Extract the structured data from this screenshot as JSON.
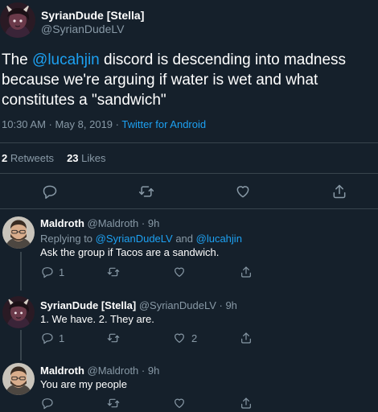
{
  "main_tweet": {
    "author_name": "SyrianDude [Stella]",
    "author_handle": "@SyrianDudeLV",
    "text_line1_pre": "The ",
    "mention": "@lucahjin",
    "text_line1_post": " discord is descending into madness",
    "text_line2": "because we're arguing if water is wet and what",
    "text_line3": "constitutes a \"sandwich\"",
    "timestamp": "10:30 AM · May 8, 2019 · ",
    "source": "Twitter for Android",
    "retweet_count": "2",
    "retweet_label": "Retweets",
    "like_count": "23",
    "like_label": "Likes"
  },
  "replies": [
    {
      "author_name": "Maldroth",
      "author_handle": "@Maldroth · 9h",
      "replying_prefix": "Replying to ",
      "replying_user1": "@SyrianDudeLV",
      "replying_and": " and ",
      "replying_user2": "@lucahjin",
      "text": "Ask the group if Tacos are a sandwich.",
      "reply_count": "1",
      "retweet_count": "",
      "like_count": ""
    },
    {
      "author_name": "SyrianDude [Stella]",
      "author_handle": "@SyrianDudeLV · 9h",
      "text": "1. We have. 2. They are.",
      "reply_count": "1",
      "retweet_count": "",
      "like_count": "2"
    },
    {
      "author_name": "Maldroth",
      "author_handle": "@Maldroth · 9h",
      "text": "You are my people"
    }
  ],
  "icons": {
    "reply": "reply-icon",
    "retweet": "retweet-icon",
    "like": "heart-icon",
    "share": "share-icon"
  },
  "colors": {
    "background": "#15202b",
    "link": "#1da1f2",
    "muted": "#8899a6",
    "divider": "#38444d"
  }
}
